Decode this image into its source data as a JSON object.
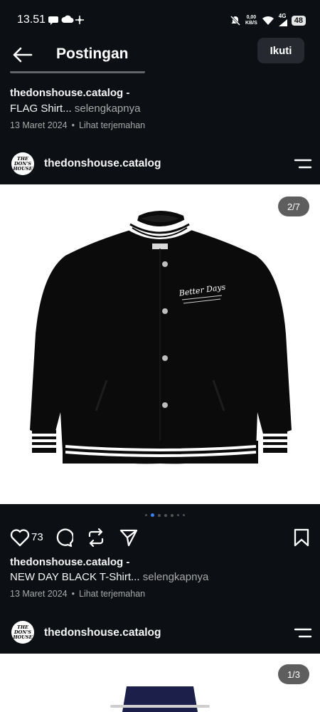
{
  "status_bar": {
    "time": "13.51",
    "net_speed_value": "0,00",
    "net_speed_unit": "KB/S",
    "network_type": "4G",
    "battery": "48"
  },
  "header": {
    "title": "Postingan",
    "follow_label": "Ikuti"
  },
  "post_prev": {
    "username": "thedonshouse.catalog -",
    "caption": "FLAG Shirt...",
    "more": " selengkapnya",
    "date": "13 Maret 2024",
    "separator": "•",
    "translate": "Lihat terjemahan"
  },
  "post_main": {
    "username": "thedonshouse.catalog",
    "avatar_text_1": "THE",
    "avatar_text_2": "DON'S",
    "avatar_text_3": "HOUSE",
    "counter": "2/7",
    "likes": "73",
    "image_print": "Better Days",
    "caption_username": "thedonshouse.catalog -",
    "caption": "NEW DAY BLACK T-Shirt...",
    "more": " selengkapnya",
    "date": "13 Maret 2024",
    "separator": "•",
    "translate": "Lihat terjemahan"
  },
  "post_next": {
    "username": "thedonshouse.catalog",
    "avatar_text_1": "THE",
    "avatar_text_2": "DON'S",
    "avatar_text_3": "HOUSE",
    "counter": "1/3"
  },
  "colors": {
    "background": "#0c1014",
    "accent_blue": "#3b82f6",
    "secondary_text": "#a8a8a8"
  }
}
